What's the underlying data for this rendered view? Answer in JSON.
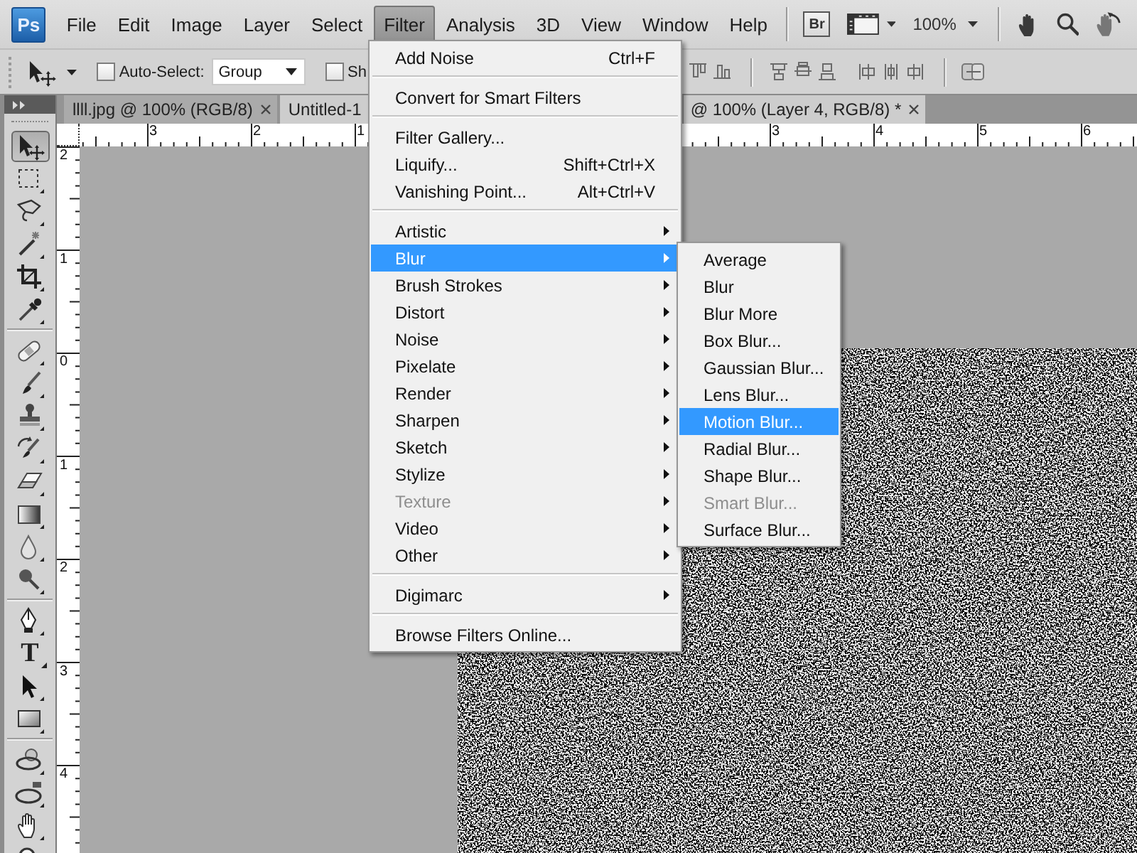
{
  "app_logo": "Ps",
  "menu_bar": {
    "items": [
      {
        "label": "File",
        "selected": false
      },
      {
        "label": "Edit",
        "selected": false
      },
      {
        "label": "Image",
        "selected": false
      },
      {
        "label": "Layer",
        "selected": false
      },
      {
        "label": "Select",
        "selected": false
      },
      {
        "label": "Filter",
        "selected": true
      },
      {
        "label": "Analysis",
        "selected": false
      },
      {
        "label": "3D",
        "selected": false
      },
      {
        "label": "View",
        "selected": false
      },
      {
        "label": "Window",
        "selected": false
      },
      {
        "label": "Help",
        "selected": false
      }
    ],
    "bridge_button": "Br",
    "zoom_level": "100%"
  },
  "options_bar": {
    "auto_select_checkbox": {
      "label": "Auto-Select:",
      "checked": false
    },
    "auto_select_dropdown": {
      "value": "Group"
    },
    "checkbox_2": {
      "label": "Sh",
      "checked": false
    }
  },
  "document_tabs": [
    {
      "label_start": "llll.jpg @ 100% (RGB/8)",
      "selected": false
    },
    {
      "label_start": "Untitled-1",
      "label_end": "@ 100% (Layer 4, RGB/8) *",
      "selected": true
    }
  ],
  "rulers": {
    "horizontal": [
      "3",
      "2",
      "1",
      "3",
      "4",
      "5",
      "6"
    ],
    "vertical": [
      "2",
      "1",
      "0",
      "1",
      "2",
      "3",
      "4"
    ]
  },
  "tool_groups": [
    [
      {
        "kind": "move",
        "selected": true
      },
      {
        "kind": "marquee",
        "selected": false
      },
      {
        "kind": "lasso",
        "selected": false
      },
      {
        "kind": "wand",
        "selected": false
      },
      {
        "kind": "crop",
        "selected": false
      },
      {
        "kind": "eyedropper",
        "selected": false
      }
    ],
    [
      {
        "kind": "healing",
        "selected": false
      },
      {
        "kind": "brush",
        "selected": false
      },
      {
        "kind": "stamp",
        "selected": false
      },
      {
        "kind": "history",
        "selected": false
      },
      {
        "kind": "eraser",
        "selected": false
      },
      {
        "kind": "gradient",
        "selected": false
      },
      {
        "kind": "drop",
        "selected": false
      },
      {
        "kind": "dodge",
        "selected": false
      }
    ],
    [
      {
        "kind": "pen",
        "selected": false
      },
      {
        "kind": "type",
        "glyph": "T",
        "selected": false
      },
      {
        "kind": "path",
        "selected": false
      },
      {
        "kind": "shape",
        "selected": false
      }
    ],
    [
      {
        "kind": "rotate3d",
        "selected": false
      },
      {
        "kind": "orbit3d",
        "selected": false
      },
      {
        "kind": "hand",
        "selected": false
      },
      {
        "kind": "zoom",
        "selected": false
      }
    ]
  ],
  "filter_menu": {
    "sections": [
      [
        {
          "label": "Add Noise",
          "shortcut": "Ctrl+F",
          "submenu": false,
          "selected": false,
          "disabled": false
        }
      ],
      [
        {
          "label": "Convert for Smart Filters",
          "submenu": false,
          "selected": false,
          "disabled": false
        }
      ],
      [
        {
          "label": "Filter Gallery...",
          "submenu": false,
          "selected": false,
          "disabled": false
        },
        {
          "label": "Liquify...",
          "shortcut": "Shift+Ctrl+X",
          "submenu": false,
          "selected": false,
          "disabled": false
        },
        {
          "label": "Vanishing Point...",
          "shortcut": "Alt+Ctrl+V",
          "submenu": false,
          "selected": false,
          "disabled": false
        }
      ],
      [
        {
          "label": "Artistic",
          "submenu": true,
          "selected": false,
          "disabled": false
        },
        {
          "label": "Blur",
          "submenu": true,
          "selected": true,
          "disabled": false
        },
        {
          "label": "Brush Strokes",
          "submenu": true,
          "selected": false,
          "disabled": false
        },
        {
          "label": "Distort",
          "submenu": true,
          "selected": false,
          "disabled": false
        },
        {
          "label": "Noise",
          "submenu": true,
          "selected": false,
          "disabled": false
        },
        {
          "label": "Pixelate",
          "submenu": true,
          "selected": false,
          "disabled": false
        },
        {
          "label": "Render",
          "submenu": true,
          "selected": false,
          "disabled": false
        },
        {
          "label": "Sharpen",
          "submenu": true,
          "selected": false,
          "disabled": false
        },
        {
          "label": "Sketch",
          "submenu": true,
          "selected": false,
          "disabled": false
        },
        {
          "label": "Stylize",
          "submenu": true,
          "selected": false,
          "disabled": false
        },
        {
          "label": "Texture",
          "submenu": true,
          "selected": false,
          "disabled": true
        },
        {
          "label": "Video",
          "submenu": true,
          "selected": false,
          "disabled": false
        },
        {
          "label": "Other",
          "submenu": true,
          "selected": false,
          "disabled": false
        }
      ],
      [
        {
          "label": "Digimarc",
          "submenu": true,
          "selected": false,
          "disabled": false
        }
      ],
      [
        {
          "label": "Browse Filters Online...",
          "submenu": false,
          "selected": false,
          "disabled": false
        }
      ]
    ]
  },
  "blur_submenu": {
    "items": [
      {
        "label": "Average",
        "selected": false,
        "disabled": false
      },
      {
        "label": "Blur",
        "selected": false,
        "disabled": false
      },
      {
        "label": "Blur More",
        "selected": false,
        "disabled": false
      },
      {
        "label": "Box Blur...",
        "selected": false,
        "disabled": false
      },
      {
        "label": "Gaussian Blur...",
        "selected": false,
        "disabled": false
      },
      {
        "label": "Lens Blur...",
        "selected": false,
        "disabled": false
      },
      {
        "label": "Motion Blur...",
        "selected": true,
        "disabled": false
      },
      {
        "label": "Radial Blur...",
        "selected": false,
        "disabled": false
      },
      {
        "label": "Shape Blur...",
        "selected": false,
        "disabled": false
      },
      {
        "label": "Smart Blur...",
        "selected": false,
        "disabled": true
      },
      {
        "label": "Surface Blur...",
        "selected": false,
        "disabled": false
      }
    ]
  }
}
